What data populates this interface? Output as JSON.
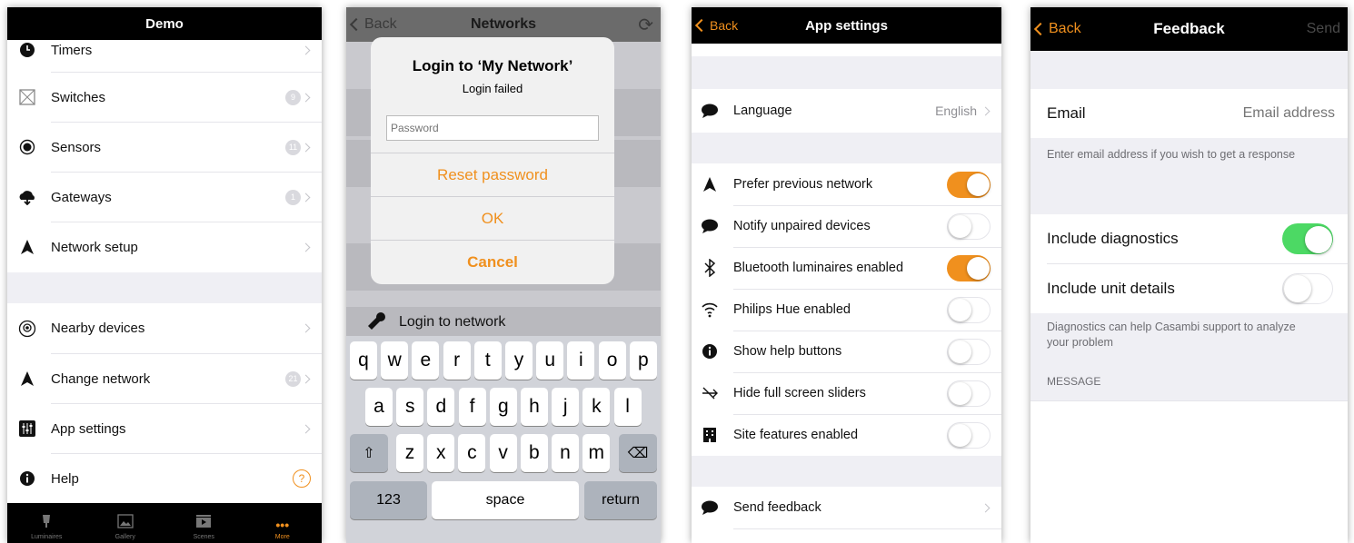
{
  "colors": {
    "accent": "#f0901e",
    "green": "#4cd964",
    "bar": "#000000"
  },
  "panel1": {
    "title": "Demo",
    "items": [
      {
        "label": "Timers",
        "icon": "clock-icon",
        "badge": ""
      },
      {
        "label": "Switches",
        "icon": "switch-icon",
        "badge": "9"
      },
      {
        "label": "Sensors",
        "icon": "sensor-icon",
        "badge": "11"
      },
      {
        "label": "Gateways",
        "icon": "gateway-icon",
        "badge": "1"
      },
      {
        "label": "Network setup",
        "icon": "network-icon",
        "badge": ""
      }
    ],
    "items2": [
      {
        "label": "Nearby devices",
        "icon": "nearby-icon",
        "badge": ""
      },
      {
        "label": "Change network",
        "icon": "network-icon",
        "badge": "21"
      },
      {
        "label": "App settings",
        "icon": "settings-icon",
        "badge": ""
      },
      {
        "label": "Help",
        "icon": "info-icon",
        "badge": ""
      }
    ],
    "help_symbol": "?",
    "tabs": [
      "Luminaires",
      "Gallery",
      "Scenes",
      "More"
    ]
  },
  "panel2": {
    "back": "Back",
    "title": "Networks",
    "alert_title": "Login to ‘My Network’",
    "alert_sub": "Login failed",
    "password_placeholder": "Password",
    "btn_reset": "Reset password",
    "btn_ok": "OK",
    "btn_cancel": "Cancel",
    "bg_row": "Login to network",
    "kb_row1": [
      "q",
      "w",
      "e",
      "r",
      "t",
      "y",
      "u",
      "i",
      "o",
      "p"
    ],
    "kb_row2": [
      "a",
      "s",
      "d",
      "f",
      "g",
      "h",
      "j",
      "k",
      "l"
    ],
    "kb_row3": [
      "z",
      "x",
      "c",
      "v",
      "b",
      "n",
      "m"
    ],
    "kb_numbers": "123",
    "kb_space": "space",
    "kb_return": "return"
  },
  "panel3": {
    "back": "Back",
    "title": "App settings",
    "language_label": "Language",
    "language_value": "English",
    "toggles": [
      {
        "label": "Prefer previous network",
        "on": true,
        "icon": "navigation-arrow-icon"
      },
      {
        "label": "Notify unpaired devices",
        "on": false,
        "icon": "speech-bubble-icon"
      },
      {
        "label": "Bluetooth luminaires enabled",
        "on": true,
        "icon": "bluetooth-icon"
      },
      {
        "label": "Philips Hue enabled",
        "on": false,
        "icon": "wifi-icon"
      },
      {
        "label": "Show help buttons",
        "on": false,
        "icon": "info-icon"
      },
      {
        "label": "Hide full screen sliders",
        "on": false,
        "icon": "slider-hide-icon"
      },
      {
        "label": "Site features enabled",
        "on": false,
        "icon": "building-icon"
      }
    ],
    "send_feedback": "Send feedback"
  },
  "panel4": {
    "back": "Back",
    "title": "Feedback",
    "send": "Send",
    "email_label": "Email",
    "email_placeholder": "Email address",
    "email_note": "Enter email address if you wish to get a response",
    "diag_label": "Include diagnostics",
    "diag_on": true,
    "unit_label": "Include unit details",
    "unit_on": false,
    "diag_note": "Diagnostics can help Casambi support to analyze your problem",
    "message_header": "MESSAGE"
  }
}
